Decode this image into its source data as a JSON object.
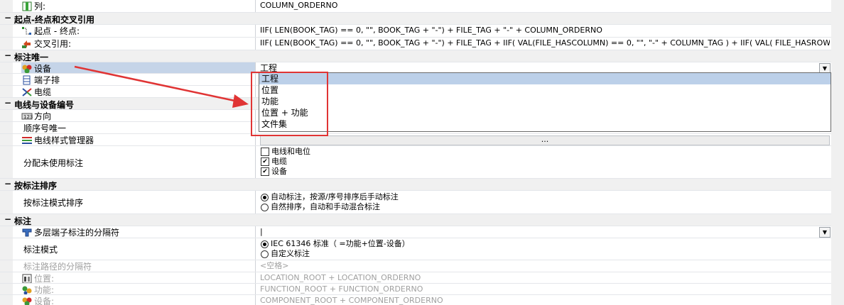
{
  "rows": {
    "column": {
      "label": "列:",
      "value": "COLUMN_ORDERNO"
    },
    "cat_start": {
      "label": "起点-终点和交叉引用"
    },
    "start_end": {
      "label": "起点 - 终点:",
      "value": "IIF( LEN(BOOK_TAG) == 0, \"\", BOOK_TAG + \"-\") + FILE_TAG + \"-\" + COLUMN_ORDERNO"
    },
    "cross_ref": {
      "label": "交叉引用:",
      "value": "IIF( LEN(BOOK_TAG) == 0, \"\", BOOK_TAG + \"-\") + FILE_TAG + IIF( VAL(FILE_HASCOLUMN) == 0, \"\", \"-\" + COLUMN_TAG ) + IIF( VAL( FILE_HASROW) == 0, \"\", \""
    },
    "cat_unique": {
      "label": "标注唯一"
    },
    "device": {
      "label": "设备",
      "value": "工程"
    },
    "terminal": {
      "label": "端子排"
    },
    "cable": {
      "label": "电缆"
    },
    "cat_wire": {
      "label": "电线与设备编号"
    },
    "direction": {
      "label": "方向"
    },
    "seq_unique": {
      "label": "顺序号唯一"
    },
    "wire_style": {
      "label": "电线样式管理器",
      "value": "..."
    },
    "unused": {
      "label": "分配未使用标注",
      "options": [
        {
          "label": "电线和电位",
          "checked": false
        },
        {
          "label": "电缆",
          "checked": true
        },
        {
          "label": "设备",
          "checked": true
        }
      ]
    },
    "cat_sort": {
      "label": "按标注排序"
    },
    "sort_mode": {
      "label": "按标注模式排序",
      "options": [
        {
          "label": "自动标注，按源/序号排序后手动标注",
          "selected": true
        },
        {
          "label": "自然排序，自动和手动混合标注",
          "selected": false
        }
      ]
    },
    "cat_tag": {
      "label": "标注"
    },
    "multi_sep": {
      "label": "多层端子标注的分隔符",
      "value": "|"
    },
    "tag_mode": {
      "label": "标注模式",
      "options": [
        {
          "label": "IEC 61346 标准（ =功能+位置-设备）",
          "selected": true
        },
        {
          "label": "自定义标注",
          "selected": false
        }
      ]
    },
    "path_sep": {
      "label": "标注路径的分隔符",
      "value": "<空格>"
    },
    "location": {
      "label": "位置:",
      "value": "LOCATION_ROOT + LOCATION_ORDERNO"
    },
    "function": {
      "label": "功能:",
      "value": "FUNCTION_ROOT + FUNCTION_ORDERNO"
    },
    "component": {
      "label": "设备:",
      "value": "COMPONENT_ROOT + COMPONENT_ORDERNO"
    }
  },
  "dropdown": {
    "items": [
      "工程",
      "位置",
      "功能",
      "位置 + 功能",
      "文件集"
    ],
    "selected": 0
  },
  "fx_label": "fx",
  "colors": {
    "accent": "#c5d4e8",
    "highlight_box": "#e03434",
    "arrow": "#e03434",
    "category_bg": "#f0f0f0"
  }
}
